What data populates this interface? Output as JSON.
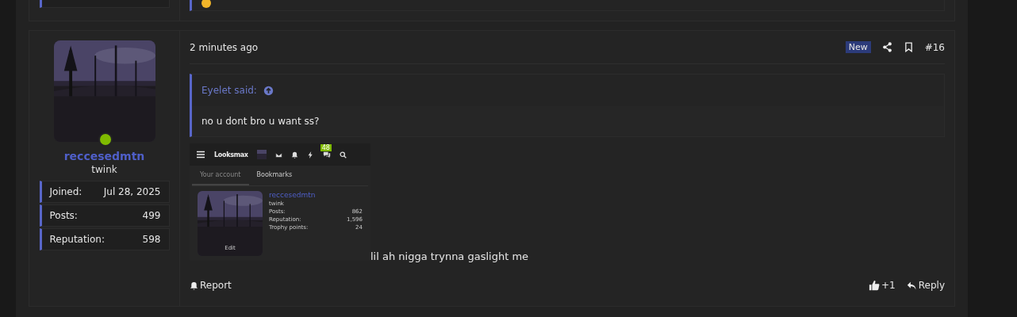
{
  "post": {
    "author": {
      "name": "reccesedmtn",
      "title": "twink",
      "online": true,
      "stats": [
        {
          "label": "Joined:",
          "value": "Jul 28, 2025"
        },
        {
          "label": "Posts:",
          "value": "499"
        },
        {
          "label": "Reputation:",
          "value": "598"
        }
      ]
    },
    "time": "2 minutes ago",
    "badge": "New",
    "number": "#16",
    "quote": {
      "author": "Eyelet said:",
      "text": "no u dont bro u want ss?"
    },
    "screenshot": {
      "logo": "Looksmax",
      "chat_count": "48",
      "tabs": [
        {
          "label": "Your account",
          "selected": true
        },
        {
          "label": "Bookmarks",
          "selected": false
        }
      ],
      "account": {
        "name": "reccesedmtn",
        "title": "twink",
        "edit": "Edit",
        "stats": [
          {
            "label": "Posts:",
            "value": "862"
          },
          {
            "label": "Reputation:",
            "value": "1,596"
          },
          {
            "label": "Trophy points:",
            "value": "24"
          }
        ]
      }
    },
    "message": "lil ah nigga trynna gaslight me",
    "report": "Report",
    "reaction": "+1",
    "reply": "Reply"
  }
}
